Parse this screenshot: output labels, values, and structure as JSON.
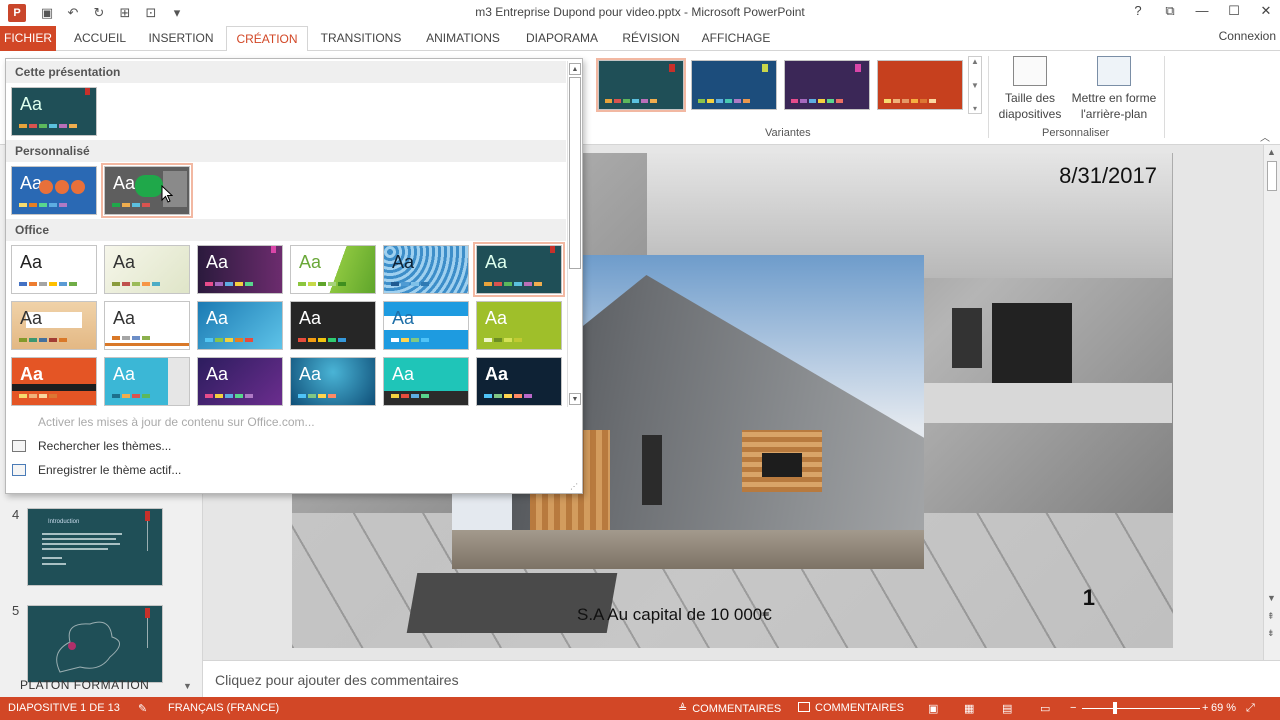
{
  "window": {
    "title": "m3 Entreprise Dupond pour video.pptx - Microsoft PowerPoint",
    "app_icon": "P",
    "connexion": "Connexion"
  },
  "tabs": [
    "FICHIER",
    "ACCUEIL",
    "INSERTION",
    "CRÉATION",
    "TRANSITIONS",
    "ANIMATIONS",
    "DIAPORAMA",
    "RÉVISION",
    "AFFICHAGE"
  ],
  "active_tab": "CRÉATION",
  "ribbon": {
    "variants_label": "Variantes",
    "personnaliser_label": "Personnaliser",
    "slide_size_label": "Taille des diapositives",
    "format_background_label": "Mettre en forme l'arrière-plan"
  },
  "dropdown": {
    "section_this": "Cette présentation",
    "section_custom": "Personnalisé",
    "section_office": "Office",
    "theme_text": "Aa",
    "menu": {
      "update": "Activer les mises à jour de contenu sur Office.com...",
      "browse": "Rechercher les thèmes...",
      "save": "Enregistrer le thème actif..."
    }
  },
  "slides_pane": {
    "slide4_number": "4",
    "slide4_title": "Introduction",
    "slide5_number": "5",
    "footer_text": "PLATON FORMATION"
  },
  "slide": {
    "date": "8/31/2017",
    "page_number": "1",
    "capital_text": "S.A Au capital de 10 000€"
  },
  "notes_placeholder": "Cliquez pour ajouter des commentaires",
  "status": {
    "slide_info": "DIAPOSITIVE 1 DE 13",
    "language": "FRANÇAIS (FRANCE)",
    "comments_1": "COMMENTAIRES",
    "comments_2": "COMMENTAIRES",
    "zoom": "69 %"
  },
  "colors": {
    "accent": "#d24726",
    "selection_outline": "#f2b8a2"
  },
  "icons": [
    "save-icon",
    "undo-icon",
    "redo-icon",
    "help-icon",
    "minimize-icon",
    "maximize-icon",
    "close-icon"
  ]
}
